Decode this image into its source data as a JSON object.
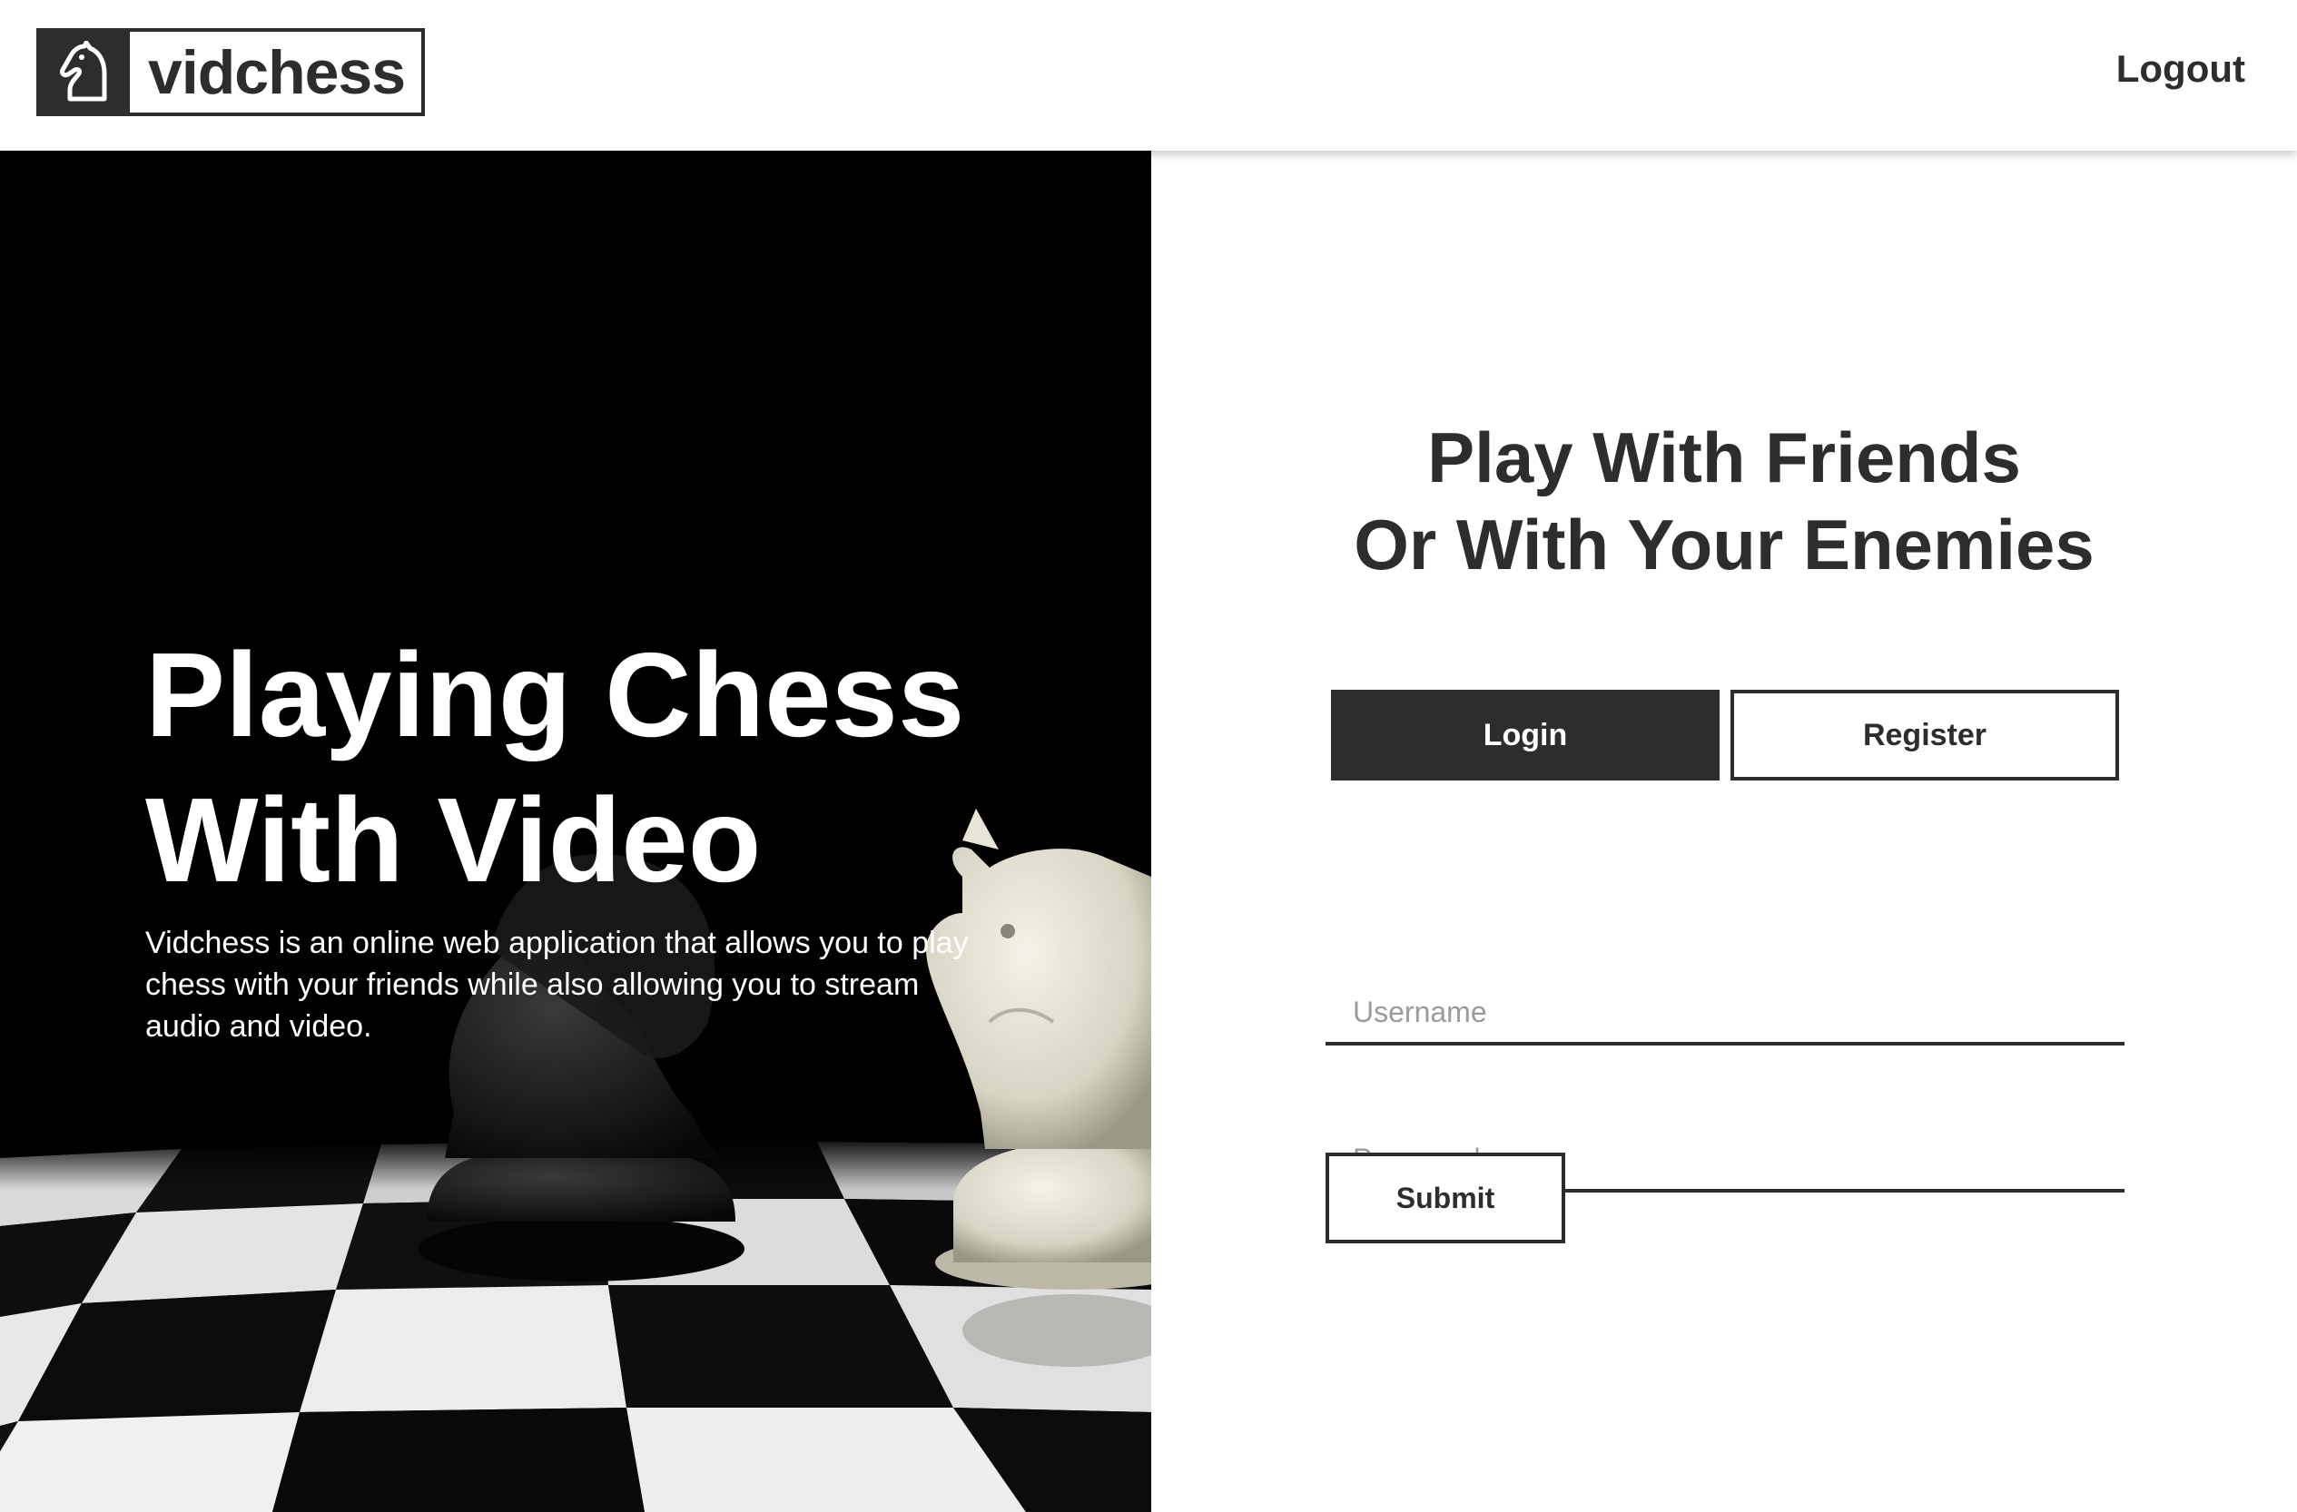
{
  "header": {
    "logo_text": "vidchess",
    "logout_label": "Logout"
  },
  "hero": {
    "title_line1": "Playing Chess",
    "title_line2": "With Video",
    "description": "Vidchess is an online web application that allows you to play chess with your friends while also allowing you to stream audio and video."
  },
  "panel": {
    "tagline_line1": "Play With Friends",
    "tagline_line2": "Or With Your Enemies",
    "tabs": [
      {
        "label": "Login",
        "active": true
      },
      {
        "label": "Register",
        "active": false
      }
    ],
    "username_placeholder": "Username",
    "password_placeholder": "Password",
    "submit_label": "Submit"
  },
  "colors": {
    "primary": "#2d2d2d",
    "background": "#ffffff",
    "placeholder": "#9a9a9a"
  },
  "icons": {
    "logo": "chess-knight-icon"
  }
}
